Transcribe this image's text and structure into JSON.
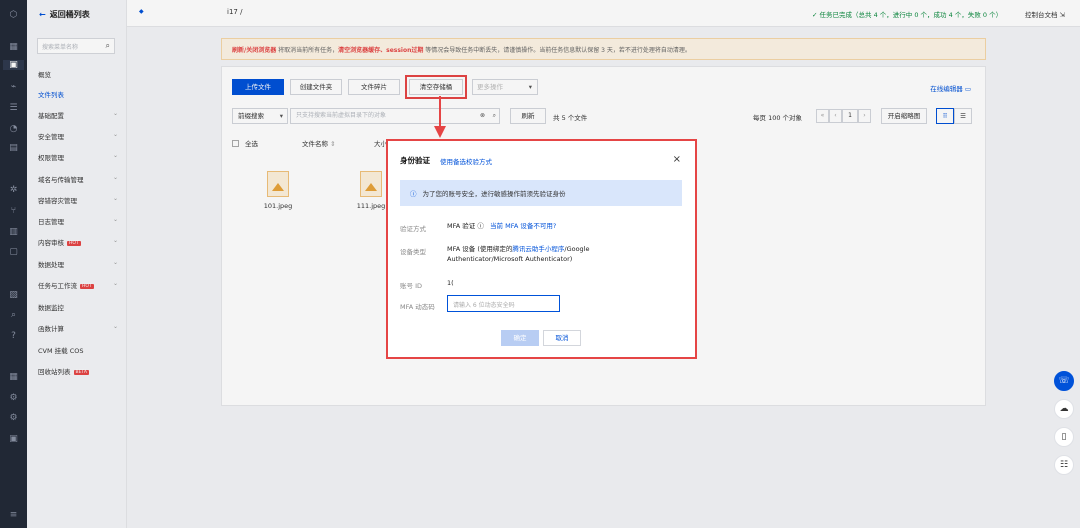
{
  "rail": {
    "icons": [
      "logo-icon",
      "grid-icon",
      "storage-icon",
      "chart-icon",
      "list-icon",
      "pie-icon",
      "doc-icon",
      "gear-icon",
      "flow-icon",
      "table-icon",
      "box-icon",
      "shield-icon",
      "search-icon",
      "help-icon",
      "calc-icon",
      "settings-icon",
      "cog-icon",
      "box2-icon",
      "menu-icon"
    ]
  },
  "sidebar": {
    "back_label": "返回桶列表",
    "search_placeholder": "搜索菜单名称",
    "items": [
      {
        "label": "概览",
        "chev": false,
        "active": false
      },
      {
        "label": "文件列表",
        "chev": false,
        "active": true
      },
      {
        "label": "基础配置",
        "chev": true,
        "active": false
      },
      {
        "label": "安全管理",
        "chev": true,
        "active": false
      },
      {
        "label": "权限管理",
        "chev": true,
        "active": false
      },
      {
        "label": "域名与传输管理",
        "chev": true,
        "active": false
      },
      {
        "label": "容错容灾管理",
        "chev": true,
        "active": false
      },
      {
        "label": "日志管理",
        "chev": true,
        "active": false
      },
      {
        "label": "内容审核",
        "chev": true,
        "active": false,
        "badge": "HOT"
      },
      {
        "label": "数据处理",
        "chev": true,
        "active": false
      },
      {
        "label": "任务与工作流",
        "chev": true,
        "active": false,
        "badge": "HOT"
      },
      {
        "label": "数据监控",
        "chev": false,
        "active": false
      },
      {
        "label": "函数计算",
        "chev": true,
        "active": false
      },
      {
        "label": "CVM 挂载 COS",
        "chev": false,
        "active": false
      },
      {
        "label": "回收站列表",
        "chev": false,
        "active": false,
        "badge": "BETA"
      }
    ]
  },
  "topbar": {
    "bucket_path": "i17  /",
    "status": "任务已完成（总共 4 个，进行中 0 个，成功 4 个，失败 0 个）",
    "doc_link": "控制台文档"
  },
  "notice": {
    "part1": "刷新/关闭浏览器",
    "part2": " 将取消当前所有任务，",
    "part3": "清空浏览器缓存、session过期",
    "part4": " 等情况会导致任务中断丢失，请谨慎操作。当前任务信息默认保留 3 天，若不进行处理将自动清理。"
  },
  "toolbar": {
    "upload": "上传文件",
    "create_folder": "创建文件夹",
    "fragments": "文件碎片",
    "clear_bucket": "清空存储桶",
    "more": "更多操作",
    "online_edit": "在线编辑器"
  },
  "filterbar": {
    "prefix_select": "前缀搜索",
    "search_placeholder": "只支持搜索当前虚拟目录下的对象",
    "refresh": "刷新",
    "count": "共 5 个文件",
    "per_page": "每页 100 个对象",
    "page": "1",
    "thumbs": "开启缩略图"
  },
  "list_header": {
    "select_all": "全选",
    "filename": "文件名称",
    "size": "大小"
  },
  "files": [
    {
      "name": "101.jpeg"
    },
    {
      "name": "111.jpeg"
    }
  ],
  "modal": {
    "title": "身份验证",
    "alt_method": "使用备选校验方式",
    "info": "为了您的账号安全，进行敏感操作前须先验证身份",
    "method_label": "验证方式",
    "method_value": "MFA 验证",
    "method_link": "当前 MFA 设备不可用?",
    "device_label": "设备类型",
    "device_prefix": "MFA 设备 (使用绑定的",
    "device_link": "腾讯云助手小程序",
    "device_suffix": "/Google",
    "device_line2": "Authenticator/Microsoft Authenticator)",
    "account_label": "账号 ID",
    "account_value": "1(",
    "code_label": "MFA 动态码",
    "code_placeholder": "请输入 6 位动态安全码",
    "ok": "确定",
    "cancel": "取消"
  }
}
